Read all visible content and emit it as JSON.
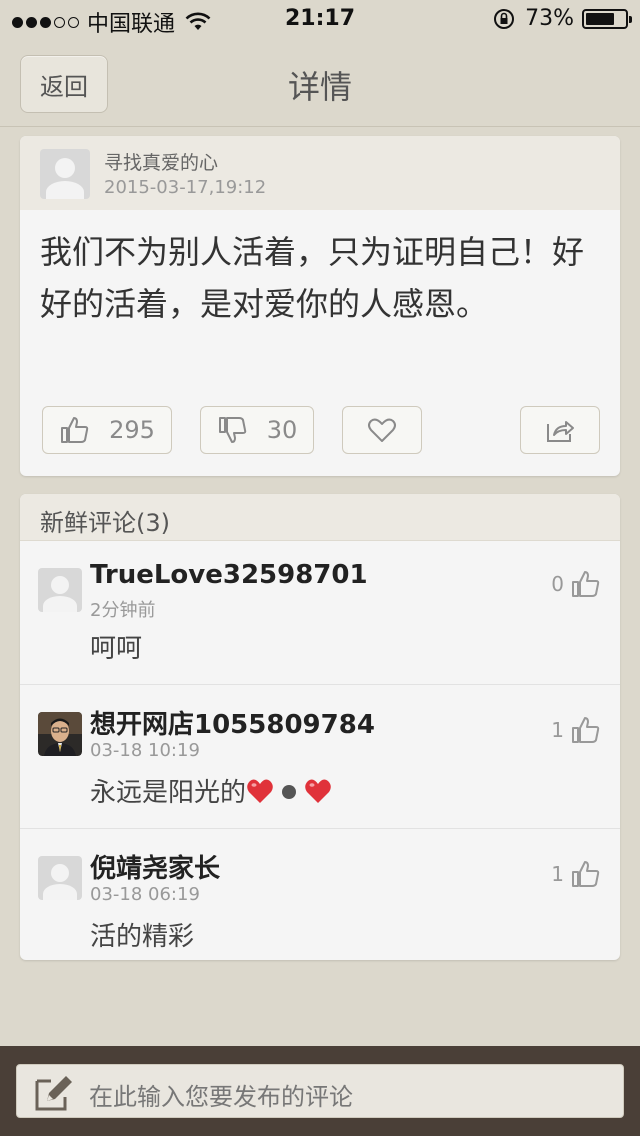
{
  "status_bar": {
    "carrier": "中国联通",
    "time": "21:17",
    "battery_text": "73%",
    "battery_level": 0.73
  },
  "nav": {
    "back_label": "返回",
    "title": "详情"
  },
  "post": {
    "author": "寻找真爱的心",
    "time": "2015-03-17,19:12",
    "content": "我们不为别人活着，只为证明自己！好好的活着，是对爱你的人感恩。",
    "likes": "295",
    "dislikes": "30"
  },
  "comments_section": {
    "title": "新鲜评论(3)",
    "comments": [
      {
        "name": "TrueLove32598701",
        "time": "2分钟前",
        "text": "呵呵",
        "likes": "0",
        "avatar": "default-avatar"
      },
      {
        "name": "想开网店1055809784",
        "time": "03-18 10:19",
        "text": "永远是阳光的",
        "likes": "1",
        "avatar": "photo-avatar"
      },
      {
        "name": "倪靖尧家长",
        "time": "03-18 06:19",
        "text": "活的精彩",
        "likes": "1",
        "avatar": "default-avatar"
      }
    ]
  },
  "input": {
    "placeholder": "在此输入您要发布的评论"
  },
  "colors": {
    "background": "#dcd8cc",
    "bottom_bar": "#4a3f37",
    "card": "#f5f5f5",
    "heart": "#e0323a"
  },
  "icons": [
    "wifi-icon",
    "lock-rotation-icon",
    "battery-icon",
    "thumbs-up-icon",
    "thumbs-down-icon",
    "heart-icon",
    "share-icon",
    "pencil-icon"
  ]
}
